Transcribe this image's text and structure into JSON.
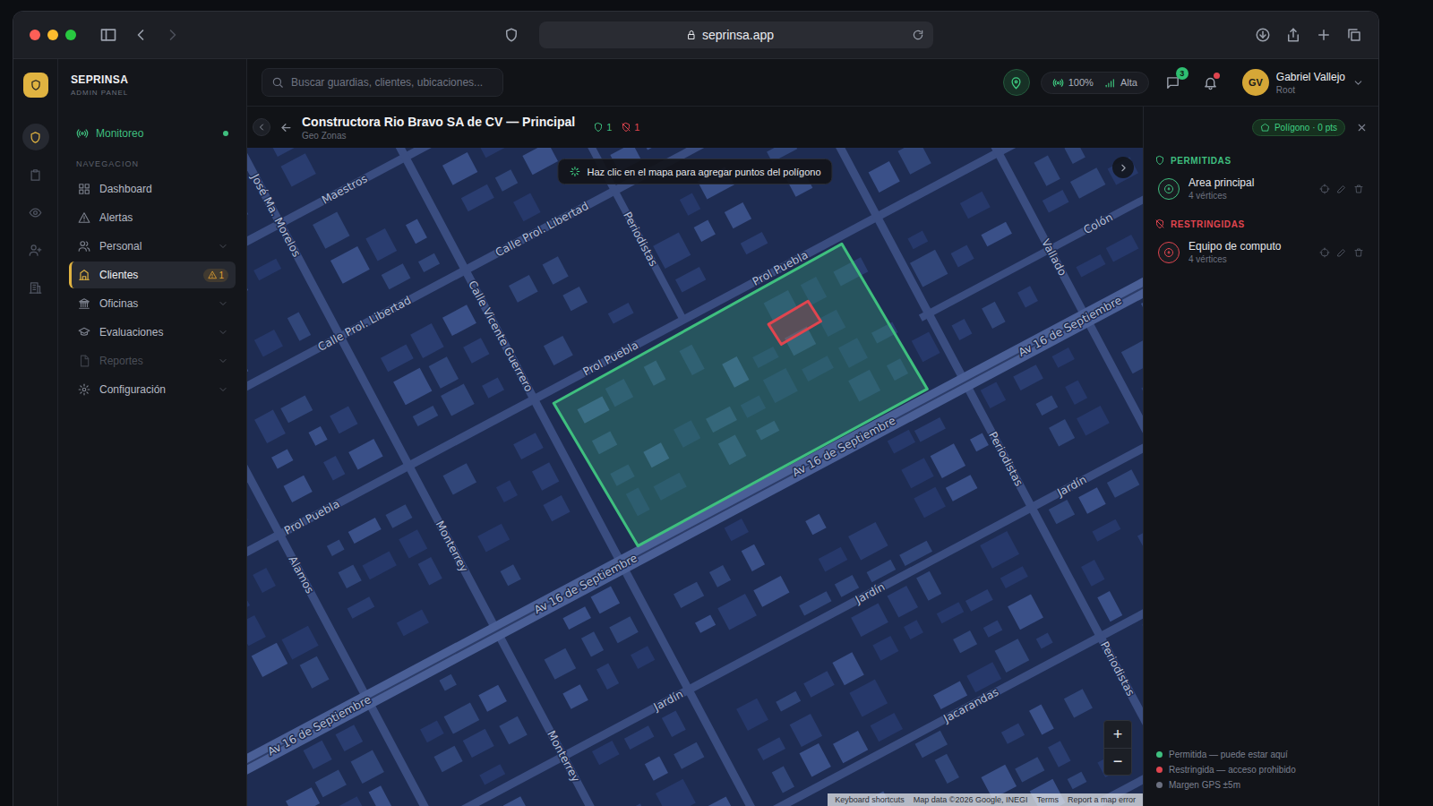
{
  "browser": {
    "url": "seprinsa.app",
    "can_go_forward": false
  },
  "brand": {
    "name": "SEPRINSA",
    "subtitle": "ADMIN PANEL"
  },
  "rail": [
    {
      "selected": true
    },
    {
      "selected": false
    },
    {
      "selected": false
    },
    {
      "selected": false
    },
    {
      "selected": false
    }
  ],
  "sidebar": {
    "live": {
      "label": "Monitoreo",
      "on": true
    },
    "section": "NAVEGACION",
    "items": [
      {
        "label": "Dashboard",
        "selected": false,
        "expandable": false,
        "disabled": false
      },
      {
        "label": "Alertas",
        "selected": false,
        "expandable": false,
        "disabled": false
      },
      {
        "label": "Personal",
        "selected": false,
        "expandable": true,
        "disabled": false
      },
      {
        "label": "Clientes",
        "selected": true,
        "expandable": false,
        "disabled": false,
        "badge": "1"
      },
      {
        "label": "Oficinas",
        "selected": false,
        "expandable": true,
        "disabled": false
      },
      {
        "label": "Evaluaciones",
        "selected": false,
        "expandable": true,
        "disabled": false
      },
      {
        "label": "Reportes",
        "selected": false,
        "expandable": true,
        "disabled": true
      },
      {
        "label": "Configuración",
        "selected": false,
        "expandable": true,
        "disabled": false
      }
    ]
  },
  "topbar": {
    "search_placeholder": "Buscar guardias, clientes, ubicaciones...",
    "gps": "100%",
    "signal": "Alta",
    "messages": "3",
    "notifications_unread": true,
    "user": {
      "initials": "GV",
      "name": "Gabriel Vallejo",
      "role": "Root"
    }
  },
  "header": {
    "title": "Constructora Rio Bravo SA de CV — Principal",
    "subtitle": "Geo Zonas",
    "allowed_count": "1",
    "restricted_count": "1"
  },
  "draw_chip": {
    "label": "Polígono · 0 pts"
  },
  "map": {
    "hint": "Haz clic en el mapa para agregar puntos del polígono",
    "labels": [
      {
        "text": "Maestros"
      },
      {
        "text": "José Ma. Morelos"
      },
      {
        "text": "Calle Prol. Libertad"
      },
      {
        "text": "Calle Prol. Libertad"
      },
      {
        "text": "Calle Vicente Guerrero"
      },
      {
        "text": "Monterrey"
      },
      {
        "text": "Monterrey"
      },
      {
        "text": "Alamos"
      },
      {
        "text": "Prol Puebla"
      },
      {
        "text": "Prol Puebla"
      },
      {
        "text": "Prol Puebla"
      },
      {
        "text": "Av 16 de Septiembre"
      },
      {
        "text": "Av 16 de Septiembre"
      },
      {
        "text": "Av 16 de Septiembre"
      },
      {
        "text": "Av 16 de Septiembre"
      },
      {
        "text": "Periodistas"
      },
      {
        "text": "Periodistas"
      },
      {
        "text": "Periodistas"
      },
      {
        "text": "Vallado"
      },
      {
        "text": "Colón"
      },
      {
        "text": "Jardín"
      },
      {
        "text": "Jardín"
      },
      {
        "text": "Jardín"
      },
      {
        "text": "Jacarandas"
      }
    ],
    "zones": [
      {
        "kind": "allowed",
        "color": "#3fbf7f"
      },
      {
        "kind": "restricted",
        "color": "#e0454f"
      }
    ],
    "zoom_in": "+",
    "zoom_out": "−",
    "attribution": [
      "Keyboard shortcuts",
      "Map data ©2026 Google, INEGI",
      "Terms",
      "Report a map error"
    ]
  },
  "panel": {
    "sections": [
      {
        "title": "PERMITIDAS",
        "color": "#3fbf7f",
        "zones": [
          {
            "name": "Area principal",
            "vertices": "4 vértices"
          }
        ]
      },
      {
        "title": "RESTRINGIDAS",
        "color": "#e0454f",
        "zones": [
          {
            "name": "Equipo de computo",
            "vertices": "4 vértices"
          }
        ]
      }
    ],
    "legend": [
      {
        "label": "Permitida — puede estar aquí",
        "color": "#3fbf7f"
      },
      {
        "label": "Restringida — acceso prohibido",
        "color": "#e0454f"
      },
      {
        "label": "Margen GPS ±5m",
        "color": "#6b7080"
      }
    ]
  }
}
